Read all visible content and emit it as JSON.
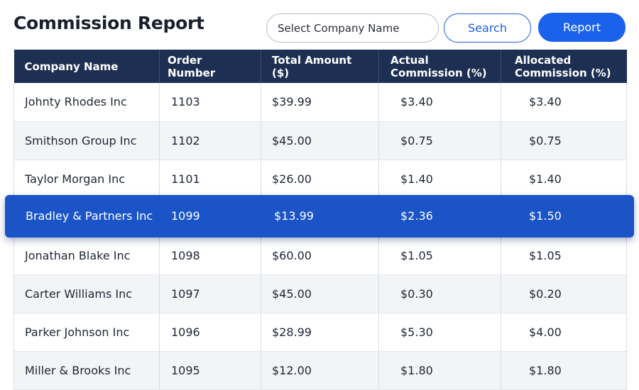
{
  "header": {
    "title": "Commission Report",
    "company_select_placeholder": "Select Company Name",
    "search_label": "Search",
    "report_label": "Report"
  },
  "table": {
    "columns": [
      "Company Name",
      "Order Number",
      "Total Amount ($)",
      "Actual Commission (%)",
      "Allocated Commission (%)"
    ],
    "rows": [
      [
        "Johnty Rhodes Inc",
        "1103",
        "$39.99",
        "$3.40",
        "$3.40"
      ],
      [
        "Smithson Group Inc",
        "1102",
        "$45.00",
        "$0.75",
        "$0.75"
      ],
      [
        "Taylor Morgan Inc",
        "1101",
        "$26.00",
        "$1.40",
        "$1.40"
      ],
      [
        "Bradley & Partners Inc",
        "1099",
        "$13.99",
        "$2.36",
        "$1.50"
      ],
      [
        "Jonathan Blake Inc",
        "1098",
        "$60.00",
        "$1.05",
        "$1.05"
      ],
      [
        "Carter Williams Inc",
        "1097",
        "$45.00",
        "$0.30",
        "$0.20"
      ],
      [
        "Parker Johnson Inc",
        "1096",
        "$28.99",
        "$5.30",
        "$4.00"
      ],
      [
        "Miller & Brooks Inc",
        "1095",
        "$12.00",
        "$1.80",
        "$1.80"
      ]
    ]
  },
  "colors": {
    "header_bg": "#1d2f52",
    "accent_blue": "#1a62eb",
    "highlight_row": "#1a54c7"
  }
}
